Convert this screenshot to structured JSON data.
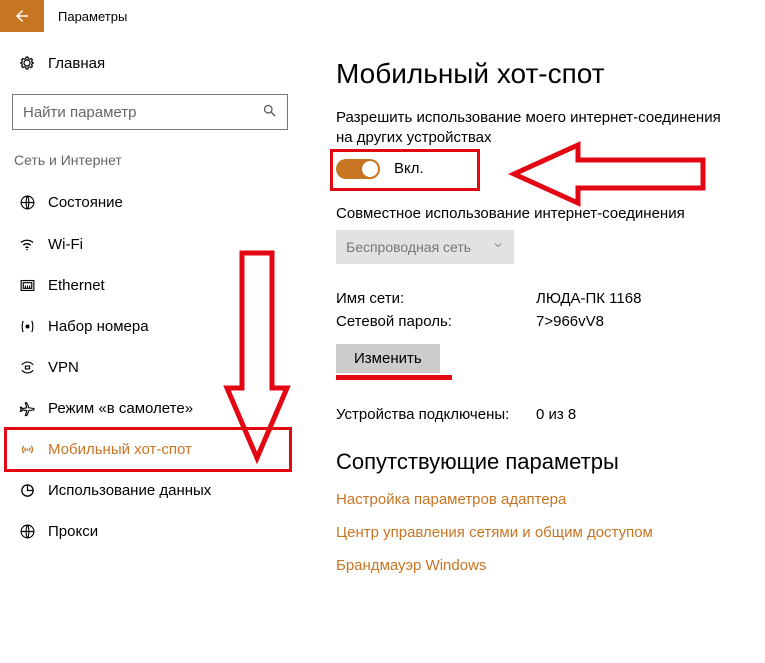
{
  "header": {
    "title": "Параметры"
  },
  "sidebar": {
    "home": "Главная",
    "search_placeholder": "Найти параметр",
    "section": "Сеть и Интернет",
    "items": [
      {
        "icon": "status",
        "label": "Состояние"
      },
      {
        "icon": "wifi",
        "label": "Wi-Fi"
      },
      {
        "icon": "ethernet",
        "label": "Ethernet"
      },
      {
        "icon": "dialup",
        "label": "Набор номера"
      },
      {
        "icon": "vpn",
        "label": "VPN"
      },
      {
        "icon": "airplane",
        "label": "Режим «в самолете»"
      },
      {
        "icon": "hotspot",
        "label": "Мобильный хот-спот"
      },
      {
        "icon": "datausage",
        "label": "Использование данных"
      },
      {
        "icon": "proxy",
        "label": "Прокси"
      }
    ]
  },
  "main": {
    "title": "Мобильный хот-спот",
    "share_desc": "Разрешить использование моего интернет-соединения на других устройствах",
    "toggle_label": "Вкл.",
    "share_from_label": "Совместное использование интернет-соединения",
    "share_from_value": "Беспроводная сеть",
    "net_name_label": "Имя сети:",
    "net_name_value": "ЛЮДА-ПК 1168",
    "net_pass_label": "Сетевой пароль:",
    "net_pass_value": "7>966vV8",
    "edit_button": "Изменить",
    "devices_label": "Устройства подключены:",
    "devices_value": "0 из 8",
    "related_title": "Сопутствующие параметры",
    "links": [
      "Настройка параметров адаптера",
      "Центр управления сетями и общим доступом",
      "Брандмауэр Windows"
    ]
  }
}
